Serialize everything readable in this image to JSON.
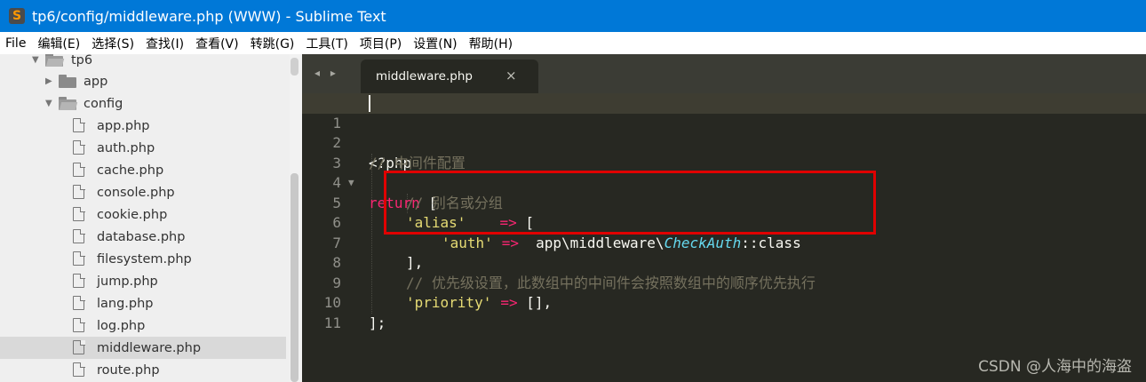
{
  "window": {
    "title": "tp6/config/middleware.php (WWW) - Sublime Text",
    "app_icon": "sublime-s-icon"
  },
  "menu": [
    "File",
    "编辑(E)",
    "选择(S)",
    "查找(I)",
    "查看(V)",
    "转跳(G)",
    "工具(T)",
    "项目(P)",
    "设置(N)",
    "帮助(H)"
  ],
  "sidebar": {
    "rows": [
      {
        "label": "tp6",
        "type": "folder-open"
      },
      {
        "label": "app",
        "type": "folder-closed"
      },
      {
        "label": "config",
        "type": "folder-open"
      },
      {
        "label": "app.php",
        "type": "file"
      },
      {
        "label": "auth.php",
        "type": "file"
      },
      {
        "label": "cache.php",
        "type": "file"
      },
      {
        "label": "console.php",
        "type": "file"
      },
      {
        "label": "cookie.php",
        "type": "file"
      },
      {
        "label": "database.php",
        "type": "file"
      },
      {
        "label": "filesystem.php",
        "type": "file"
      },
      {
        "label": "jump.php",
        "type": "file"
      },
      {
        "label": "lang.php",
        "type": "file"
      },
      {
        "label": "log.php",
        "type": "file"
      },
      {
        "label": "middleware.php",
        "type": "file",
        "selected": true
      },
      {
        "label": "route.php",
        "type": "file"
      }
    ]
  },
  "tabs": {
    "nav": "◂ ▸",
    "active": {
      "label": "middleware.php",
      "close": "×"
    }
  },
  "editor": {
    "lines": [
      {
        "n": "1",
        "text": "<?php"
      },
      {
        "n": "2",
        "text": "// 中间件配置"
      },
      {
        "n": "3",
        "text": "return ["
      },
      {
        "n": "4",
        "text": "// 别名或分组"
      },
      {
        "n": "5",
        "text": "'alias'    => ["
      },
      {
        "n": "6",
        "text": "'auth' =>  app\\middleware\\CheckAuth::class"
      },
      {
        "n": "7",
        "text": "],"
      },
      {
        "n": "8",
        "text": "// 优先级设置，此数组中的中间件会按照数组中的顺序优先执行"
      },
      {
        "n": "9",
        "text": "'priority' => [],"
      },
      {
        "n": "10",
        "text": "];"
      },
      {
        "n": "11",
        "text": ""
      }
    ],
    "tokens": {
      "l1": "<?php",
      "l2": "// 中间件配置",
      "l3_kw": "return",
      "l3_rest": " [",
      "l4": "// 别名或分组",
      "l5_str": "'alias'",
      "l5_op": "=>",
      "l5_rest": " [",
      "l6_str": "'auth'",
      "l6_op": "=>",
      "l6_ns": "app\\middleware\\",
      "l6_cls": "CheckAuth",
      "l6_rest": "::class",
      "l7": "],",
      "l8": "// 优先级设置，此数组中的中间件会按照数组中的顺序优先执行",
      "l9_str": "'priority'",
      "l9_op": "=>",
      "l9_rest": " [],",
      "l10": "];"
    }
  },
  "watermark": "CSDN @人海中的海盗",
  "colors": {
    "titlebar": "#0078d7",
    "editor_bg": "#272822",
    "highlight_box": "#e00000"
  }
}
